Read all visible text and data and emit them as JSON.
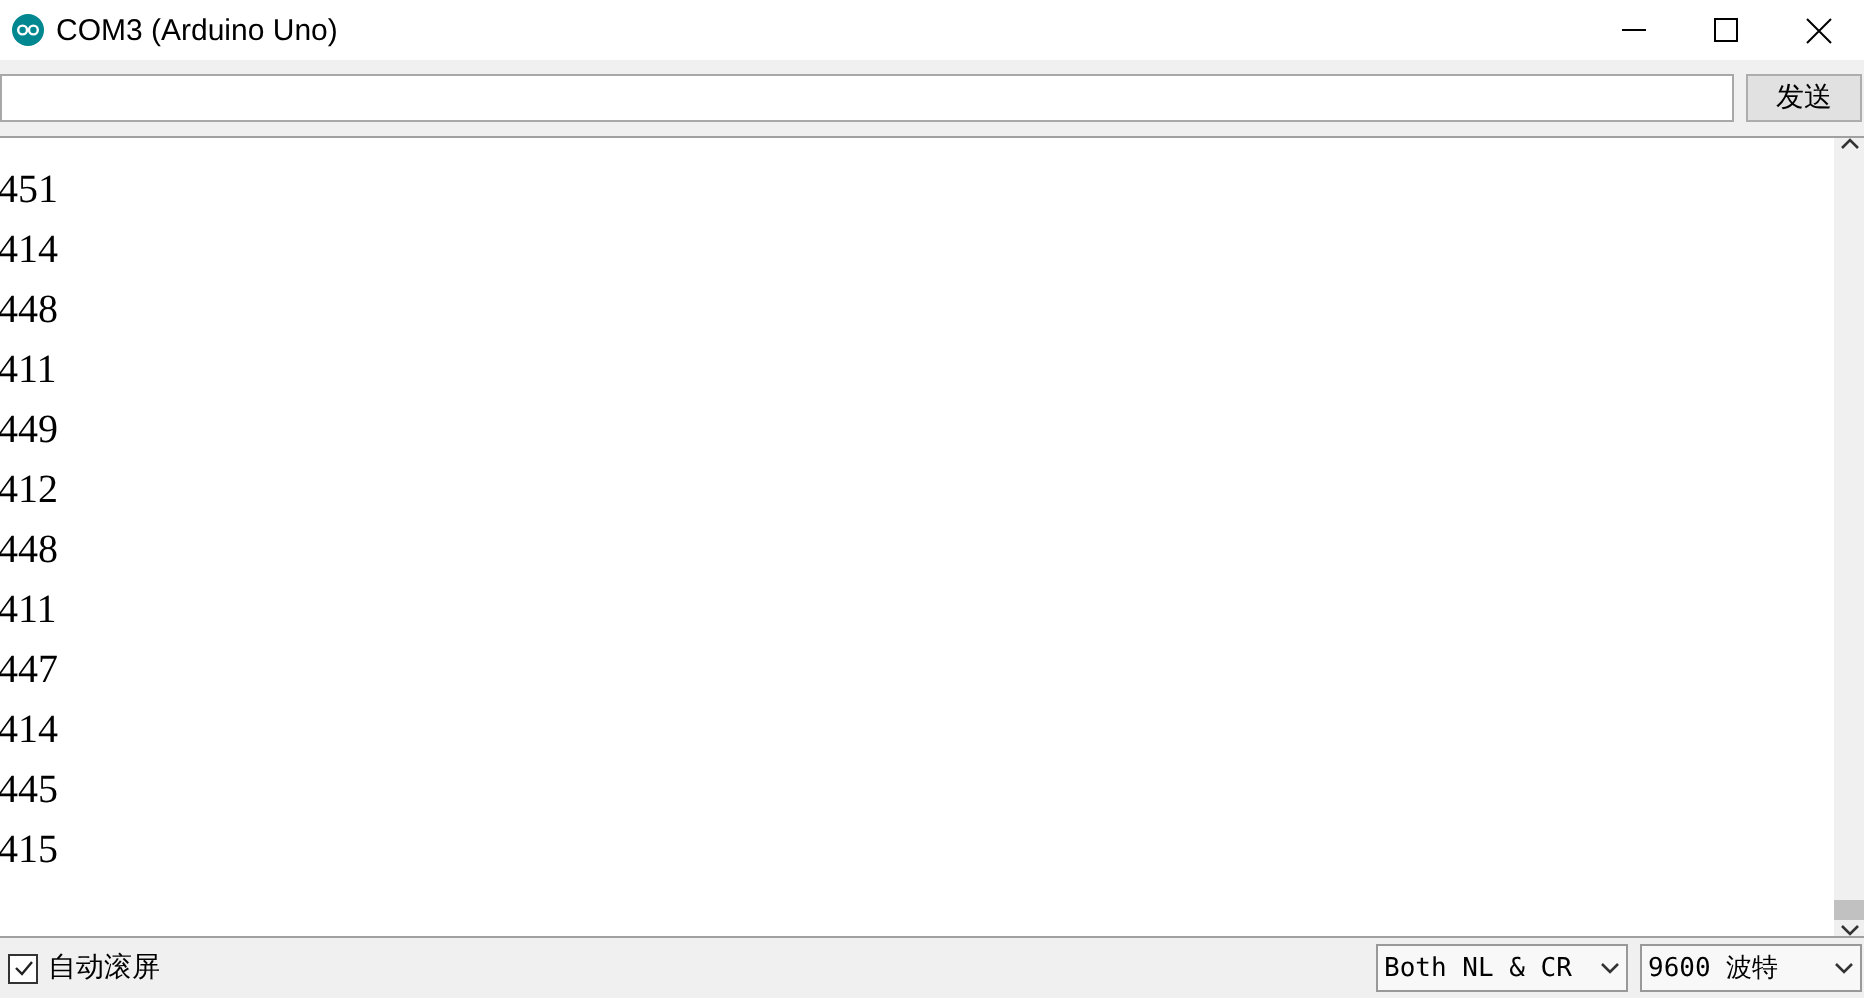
{
  "window": {
    "title": "COM3 (Arduino Uno)"
  },
  "send_bar": {
    "send_button": "发送"
  },
  "output_lines": [
    "451",
    "414",
    "448",
    "411",
    "449",
    "412",
    "448",
    "411",
    "447",
    "414",
    "445",
    "415"
  ],
  "footer": {
    "autoscroll": {
      "label": "自动滚屏",
      "checked": true
    },
    "line_ending": "Both NL & CR",
    "baud_rate": "9600 波特"
  }
}
